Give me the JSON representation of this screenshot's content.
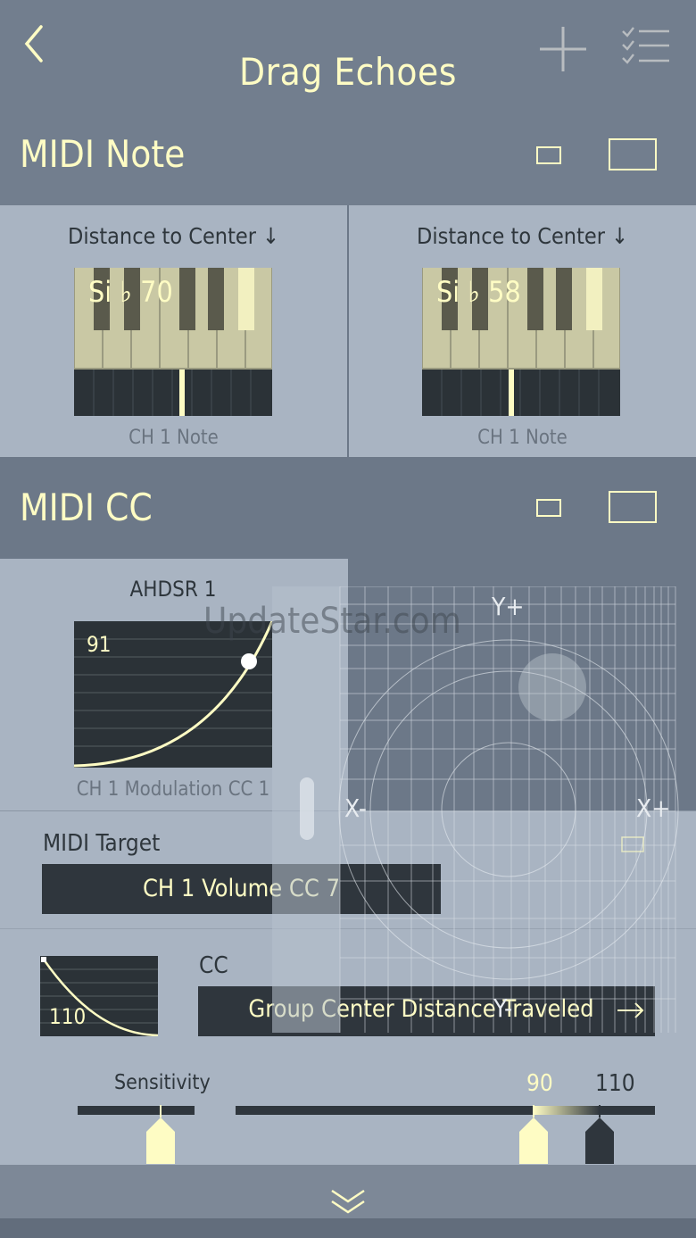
{
  "header": {
    "title": "Drag Echoes"
  },
  "midi_note": {
    "title": "MIDI Note",
    "panels": [
      {
        "source": "Distance to Center ↓",
        "note": "Si ♭ 70",
        "channel": "CH 1 Note"
      },
      {
        "source": "Distance to Center ↓",
        "note": "Si ♭ 58",
        "channel": "CH 1 Note"
      }
    ]
  },
  "midi_cc": {
    "title": "MIDI CC",
    "ahdsr": {
      "title": "AHDSR 1",
      "value": "91",
      "target": "CH 1 Modulation CC 1"
    },
    "xy_pad": {
      "y_plus": "Y+",
      "y_minus": "Y-",
      "x_minus": "X-",
      "x_plus": "X+"
    },
    "midi_target_label": "MIDI Target",
    "midi_target_value": "CH 1 Volume CC 7",
    "curve_value": "110",
    "cc_label": "CC",
    "cc_source": "Group Center Distance Traveled",
    "sensitivity_label": "Sensitivity",
    "range_low": "90",
    "range_high": "110"
  },
  "watermark": "UpdateStar.com",
  "colors": {
    "accent": "#fefcc4",
    "panel": "#a9b4c2",
    "header": "#727e8e",
    "dark": "#2b3237"
  }
}
